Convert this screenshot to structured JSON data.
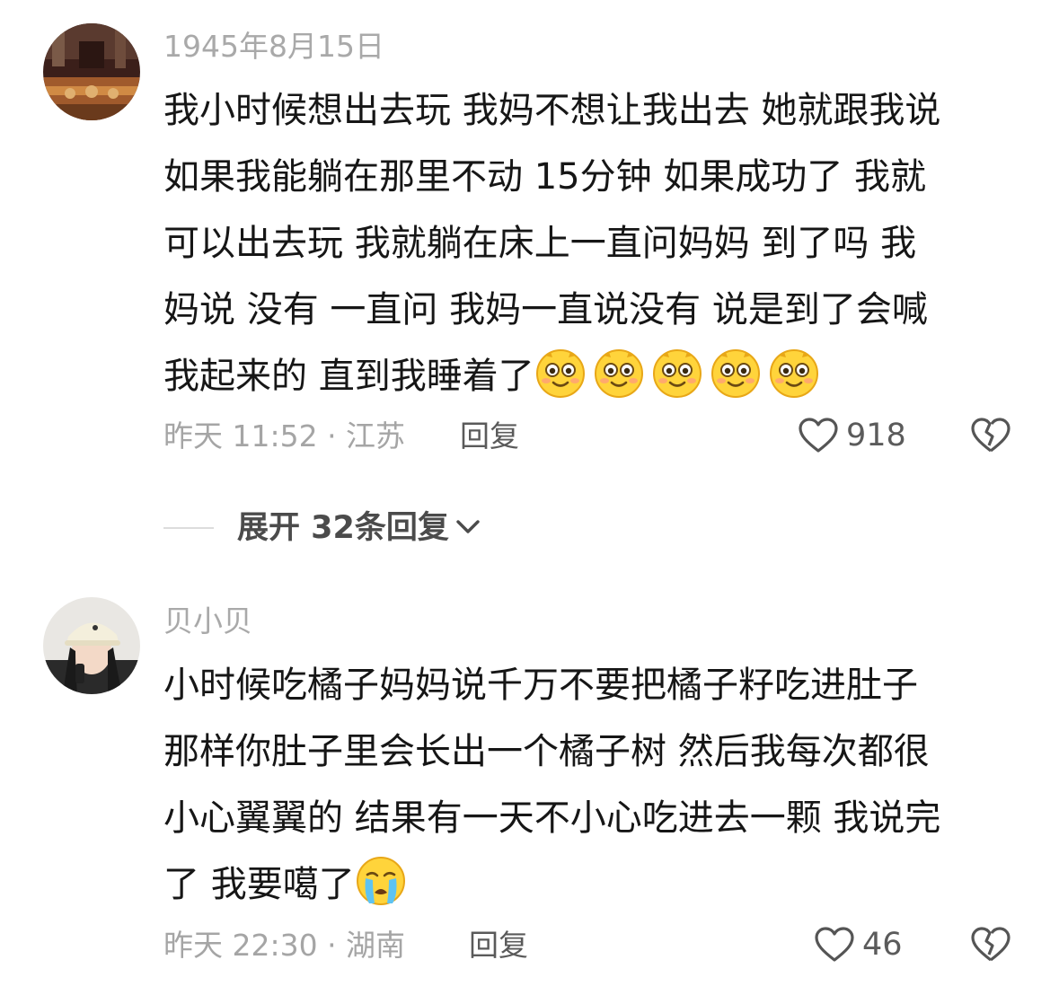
{
  "comments": [
    {
      "username": "1945年8月15日",
      "lines": [
        "我小时候想出去玩 我妈不想让我出去 她就跟我说",
        "如果我能躺在那里不动 15分钟 如果成功了 我就",
        "可以出去玩 我就躺在床上一直问妈妈 到了吗 我",
        "妈说 没有 一直问 我妈一直说没有 说是到了会喊",
        "我起来的 直到我睡着了"
      ],
      "emoji_name": "smile-emoji",
      "emoji_count": 5,
      "time_location": "昨天 11:52 · 江苏",
      "reply_label": "回复",
      "like_count": "918"
    },
    {
      "username": "贝小贝",
      "lines": [
        "小时候吃橘子妈妈说千万不要把橘子籽吃进肚子",
        "那样你肚子里会长出一个橘子树 然后我每次都很",
        "小心翼翼的 结果有一天不小心吃进去一颗 我说完",
        "了 我要噶了"
      ],
      "emoji_name": "crying-emoji",
      "emoji_count": 1,
      "time_location": "昨天 22:30 · 湖南",
      "reply_label": "回复",
      "like_count": "46"
    }
  ],
  "expand_replies": "展开 32条回复",
  "colors": {
    "text": "#161616",
    "meta": "#a5a5a5",
    "username": "#a9a9a9",
    "emoji_yellow": "#ffd43b"
  }
}
